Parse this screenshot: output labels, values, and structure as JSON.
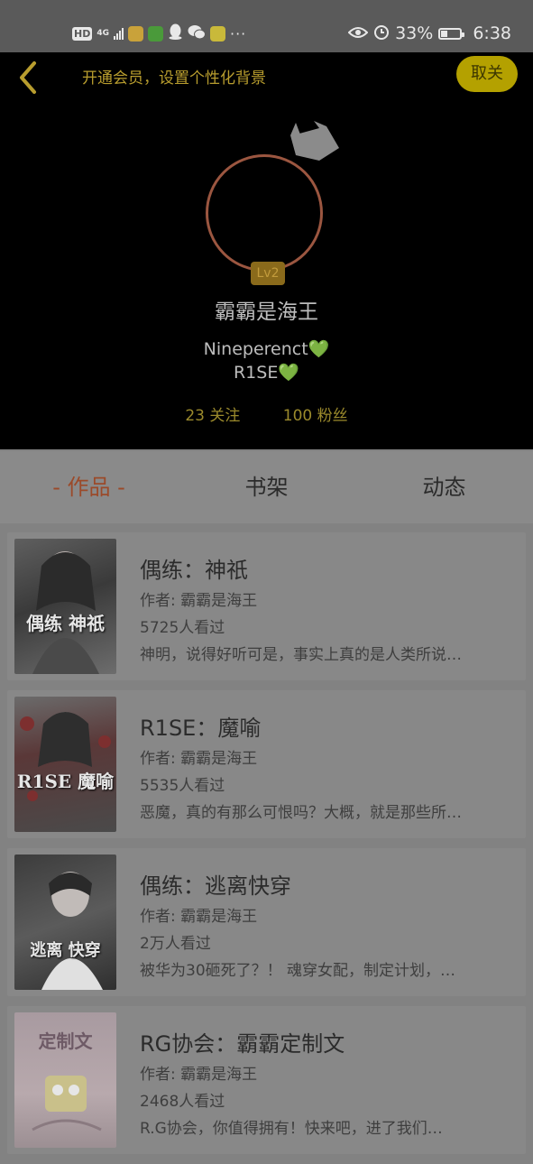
{
  "status_bar": {
    "hd": "HD",
    "network": "4G",
    "dots": "···",
    "battery_percent": "33%",
    "time": "6:38",
    "icons": [
      "signal-icon",
      "app-icon",
      "video-icon",
      "qq-icon",
      "wechat-icon",
      "app-icon",
      "eye-icon",
      "alarm-icon",
      "battery-icon"
    ]
  },
  "header": {
    "promo_text": "开通会员，设置个性化背景",
    "cancel_label": "取关",
    "level": "Lv2",
    "username": "霸霸是海王",
    "signature_line1": "Nineperenct",
    "signature_line2": "R1SE",
    "heart": "💚",
    "following": "23 关注",
    "followers": "100 粉丝"
  },
  "tabs": [
    {
      "label": "- 作品 -",
      "active": true
    },
    {
      "label": "书架",
      "active": false
    },
    {
      "label": "动态",
      "active": false
    }
  ],
  "books": [
    {
      "title": "偶练：神祇",
      "author": "作者: 霸霸是海王",
      "views": "5725人看过",
      "desc": "神明，说得好听可是，事实上真的是人类所说…",
      "cover_text": "偶练 神祇"
    },
    {
      "title": "R1SE：魔喻",
      "author": "作者: 霸霸是海王",
      "views": "5535人看过",
      "desc": "恶魔，真的有那么可恨吗？大概，就是那些所…",
      "cover_text": "R1SE 魔喻"
    },
    {
      "title": "偶练：逃离快穿",
      "author": "作者: 霸霸是海王",
      "views": "2万人看过",
      "desc": "被华为30砸死了？！ 魂穿女配，制定计划，…",
      "cover_text": "逃离 快穿"
    },
    {
      "title": "RG协会：霸霸定制文",
      "author": "作者: 霸霸是海王",
      "views": "2468人看过",
      "desc": "R.G协会，你值得拥有！快来吧，进了我们…",
      "cover_text": "定制文"
    }
  ],
  "colors": {
    "accent_gold": "#b89d2e",
    "cancel_bg": "#b4a100",
    "active_tab": "#9b4a2a",
    "avatar_ring": "#9b5640"
  }
}
